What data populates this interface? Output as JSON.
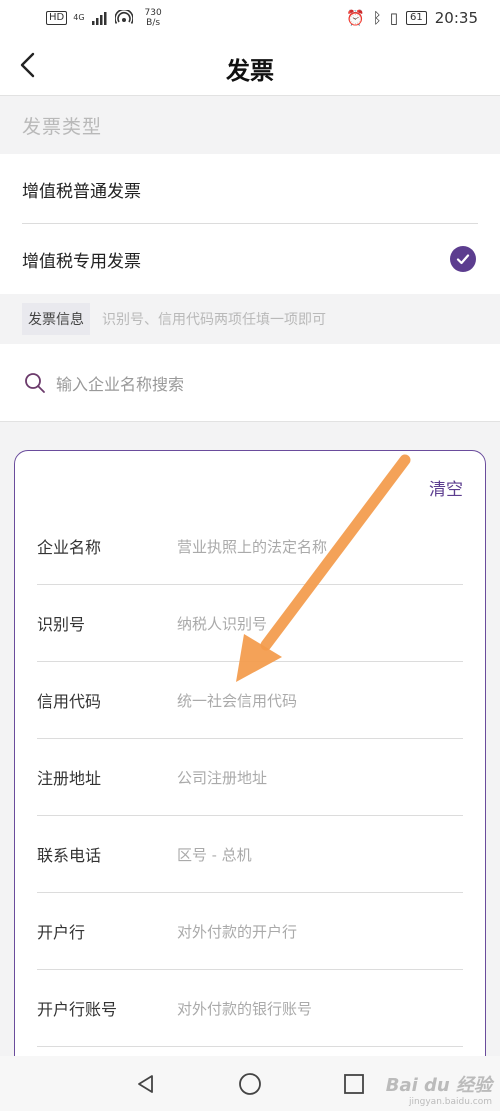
{
  "status_bar": {
    "hd": "HD",
    "network": "4G",
    "speed_value": "730",
    "speed_unit": "B/s",
    "battery": "61",
    "time": "20:35"
  },
  "header": {
    "title": "发票"
  },
  "invoice_type": {
    "label": "发票类型",
    "options": [
      {
        "label": "增值税普通发票",
        "selected": false
      },
      {
        "label": "增值税专用发票",
        "selected": true
      }
    ]
  },
  "invoice_info": {
    "tag": "发票信息",
    "hint": "识别号、信用代码两项任填一项即可"
  },
  "search": {
    "placeholder": "输入企业名称搜索"
  },
  "form": {
    "clear_label": "清空",
    "fields": [
      {
        "label": "企业名称",
        "placeholder": "营业执照上的法定名称"
      },
      {
        "label": "识别号",
        "placeholder": "纳税人识别号"
      },
      {
        "label": "信用代码",
        "placeholder": "统一社会信用代码"
      },
      {
        "label": "注册地址",
        "placeholder": "公司注册地址"
      },
      {
        "label": "联系电话",
        "placeholder": "区号 - 总机"
      },
      {
        "label": "开户行",
        "placeholder": "对外付款的开户行"
      },
      {
        "label": "开户行账号",
        "placeholder": "对外付款的银行账号"
      }
    ]
  },
  "watermark": {
    "logo": "Bai du 经验",
    "url": "jingyan.baidu.com"
  },
  "colors": {
    "accent": "#5c3d8f",
    "annotation_arrow": "#f39a4a"
  }
}
